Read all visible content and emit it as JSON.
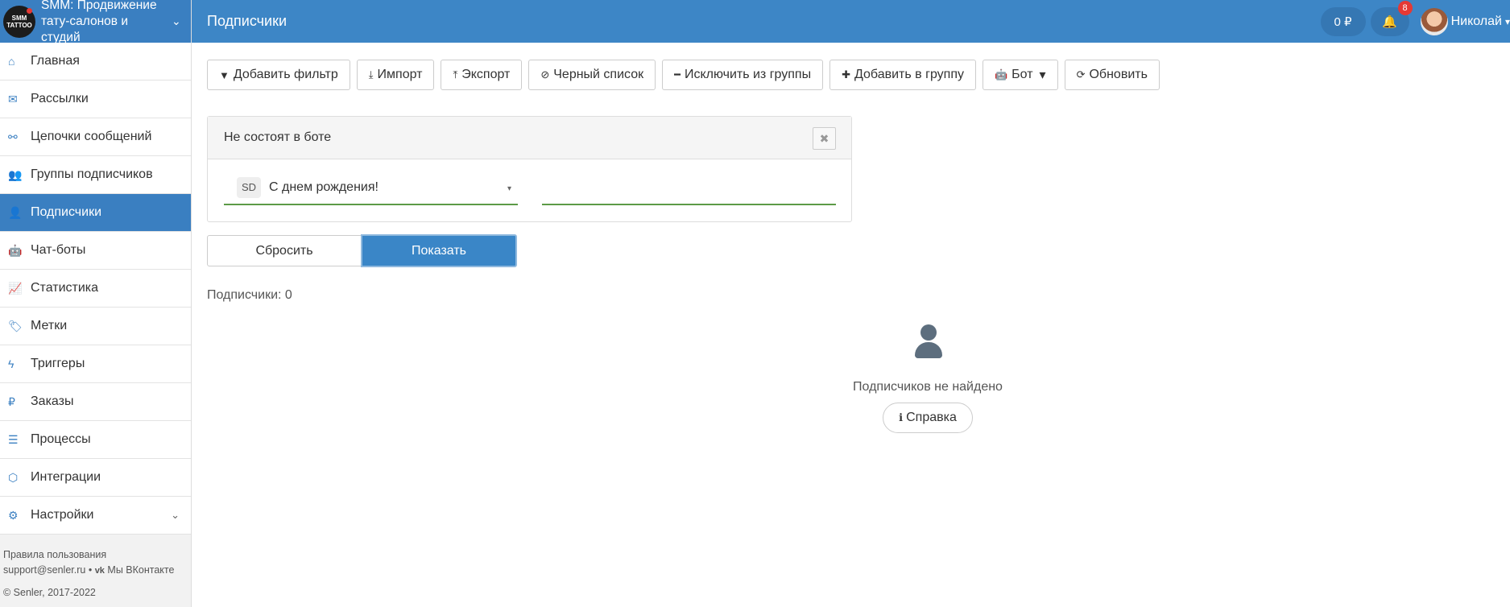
{
  "brand": {
    "logo_text": "SMM TATTOO",
    "title": "SMM: Продвижение тату-салонов и студий",
    "chevron_icon": "chevron-down-icon"
  },
  "sidebar": {
    "items": [
      {
        "label": "Главная",
        "icon": "home-icon",
        "glyph": "⌂"
      },
      {
        "label": "Рассылки",
        "icon": "envelope-icon",
        "glyph": "✉"
      },
      {
        "label": "Цепочки сообщений",
        "icon": "link-icon",
        "glyph": "⚯"
      },
      {
        "label": "Группы подписчиков",
        "icon": "users-icon",
        "glyph": "👥"
      },
      {
        "label": "Подписчики",
        "icon": "user-icon",
        "glyph": "👤",
        "active": true
      },
      {
        "label": "Чат-боты",
        "icon": "android-icon",
        "glyph": "🤖"
      },
      {
        "label": "Статистика",
        "icon": "line-chart-icon",
        "glyph": "📈"
      },
      {
        "label": "Метки",
        "icon": "tag-icon",
        "glyph": "🏷"
      },
      {
        "label": "Триггеры",
        "icon": "bolt-icon",
        "glyph": "ϟ"
      },
      {
        "label": "Заказы",
        "icon": "ruble-icon",
        "glyph": "₽"
      },
      {
        "label": "Процессы",
        "icon": "tasks-icon",
        "glyph": "☰"
      },
      {
        "label": "Интеграции",
        "icon": "cubes-icon",
        "glyph": "⬡"
      },
      {
        "label": "Настройки",
        "icon": "cogs-icon",
        "glyph": "⚙",
        "has_chevron": true
      }
    ],
    "footer": {
      "terms": "Правила пользования",
      "support": "support@senler.ru",
      "separator": "•",
      "vk_icon": "vk-icon",
      "vk_label": "Мы ВКонтакте",
      "copyright": "© Senler, 2017-2022"
    }
  },
  "header": {
    "page_title": "Подписчики",
    "balance": "0 ₽",
    "bell_icon": "bell-icon",
    "notification_count": "8",
    "user_name": "Николай"
  },
  "toolbar": [
    {
      "label": "Добавить фильтр",
      "icon": "filter-icon",
      "glyph": "▼"
    },
    {
      "label": "Импорт",
      "icon": "download-icon",
      "glyph": "⤓"
    },
    {
      "label": "Экспорт",
      "icon": "upload-icon",
      "glyph": "⤒"
    },
    {
      "label": "Черный список",
      "icon": "ban-icon",
      "glyph": "⊘"
    },
    {
      "label": "Исключить из группы",
      "icon": "minus-icon",
      "glyph": "━"
    },
    {
      "label": "Добавить в группу",
      "icon": "plus-icon",
      "glyph": "✚"
    },
    {
      "label": "Бот",
      "icon": "android-icon",
      "glyph": "🤖",
      "caret": "▾"
    },
    {
      "label": "Обновить",
      "icon": "refresh-icon",
      "glyph": "⟳"
    }
  ],
  "filter": {
    "title": "Не состоят в боте",
    "close_glyph": "✖",
    "chip": "SD",
    "selected_bot": "С днем рождения!",
    "caret": "▾",
    "value": ""
  },
  "actions": {
    "reset_label": "Сбросить",
    "show_label": "Показать"
  },
  "results": {
    "count_text": "Подписчики: 0",
    "empty_text": "Подписчиков не найдено",
    "help_label": "Справка",
    "help_glyph": "ℹ"
  },
  "colors": {
    "header_blue": "#3d86c6",
    "active_blue": "#3a7fc1",
    "input_underline_green": "#5c9a47",
    "badge_red": "#e53935"
  }
}
